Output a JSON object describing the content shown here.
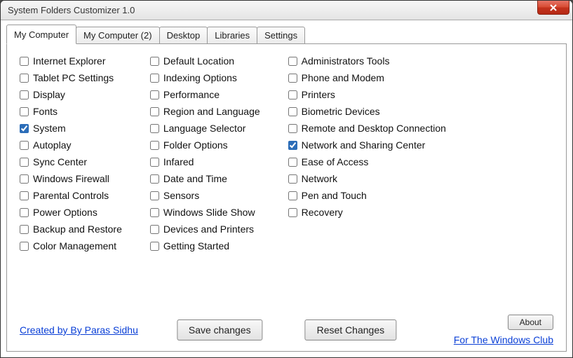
{
  "window": {
    "title": "System Folders Customizer 1.0"
  },
  "tabs": [
    {
      "label": "My Computer",
      "active": true
    },
    {
      "label": "My Computer (2)",
      "active": false
    },
    {
      "label": "Desktop",
      "active": false
    },
    {
      "label": "Libraries",
      "active": false
    },
    {
      "label": "Settings",
      "active": false
    }
  ],
  "columns": [
    [
      {
        "label": "Internet Explorer",
        "checked": false
      },
      {
        "label": "Tablet PC Settings",
        "checked": false
      },
      {
        "label": "Display",
        "checked": false
      },
      {
        "label": "Fonts",
        "checked": false
      },
      {
        "label": "System",
        "checked": true
      },
      {
        "label": "Autoplay",
        "checked": false
      },
      {
        "label": "Sync Center",
        "checked": false
      },
      {
        "label": "Windows Firewall",
        "checked": false
      },
      {
        "label": "Parental Controls",
        "checked": false
      },
      {
        "label": "Power Options",
        "checked": false
      },
      {
        "label": "Backup and Restore",
        "checked": false
      },
      {
        "label": "Color Management",
        "checked": false
      }
    ],
    [
      {
        "label": "Default Location",
        "checked": false
      },
      {
        "label": "Indexing Options",
        "checked": false
      },
      {
        "label": "Performance",
        "checked": false
      },
      {
        "label": "Region and Language",
        "checked": false
      },
      {
        "label": "Language Selector",
        "checked": false
      },
      {
        "label": "Folder Options",
        "checked": false
      },
      {
        "label": "Infared",
        "checked": false
      },
      {
        "label": "Date and Time",
        "checked": false
      },
      {
        "label": "Sensors",
        "checked": false
      },
      {
        "label": "Windows Slide Show",
        "checked": false
      },
      {
        "label": "Devices and Printers",
        "checked": false
      },
      {
        "label": "Getting Started",
        "checked": false
      }
    ],
    [
      {
        "label": "Administrators Tools",
        "checked": false
      },
      {
        "label": "Phone and Modem",
        "checked": false
      },
      {
        "label": "Printers",
        "checked": false
      },
      {
        "label": "Biometric Devices",
        "checked": false
      },
      {
        "label": "Remote and Desktop Connection",
        "checked": false
      },
      {
        "label": "Network and Sharing Center",
        "checked": true
      },
      {
        "label": "Ease of Access",
        "checked": false
      },
      {
        "label": "Network",
        "checked": false
      },
      {
        "label": "Pen and Touch",
        "checked": false
      },
      {
        "label": "Recovery",
        "checked": false
      }
    ]
  ],
  "buttons": {
    "save": "Save changes",
    "reset": "Reset Changes",
    "about": "About"
  },
  "links": {
    "author": "Created by By Paras Sidhu",
    "site": "For The Windows Club"
  }
}
